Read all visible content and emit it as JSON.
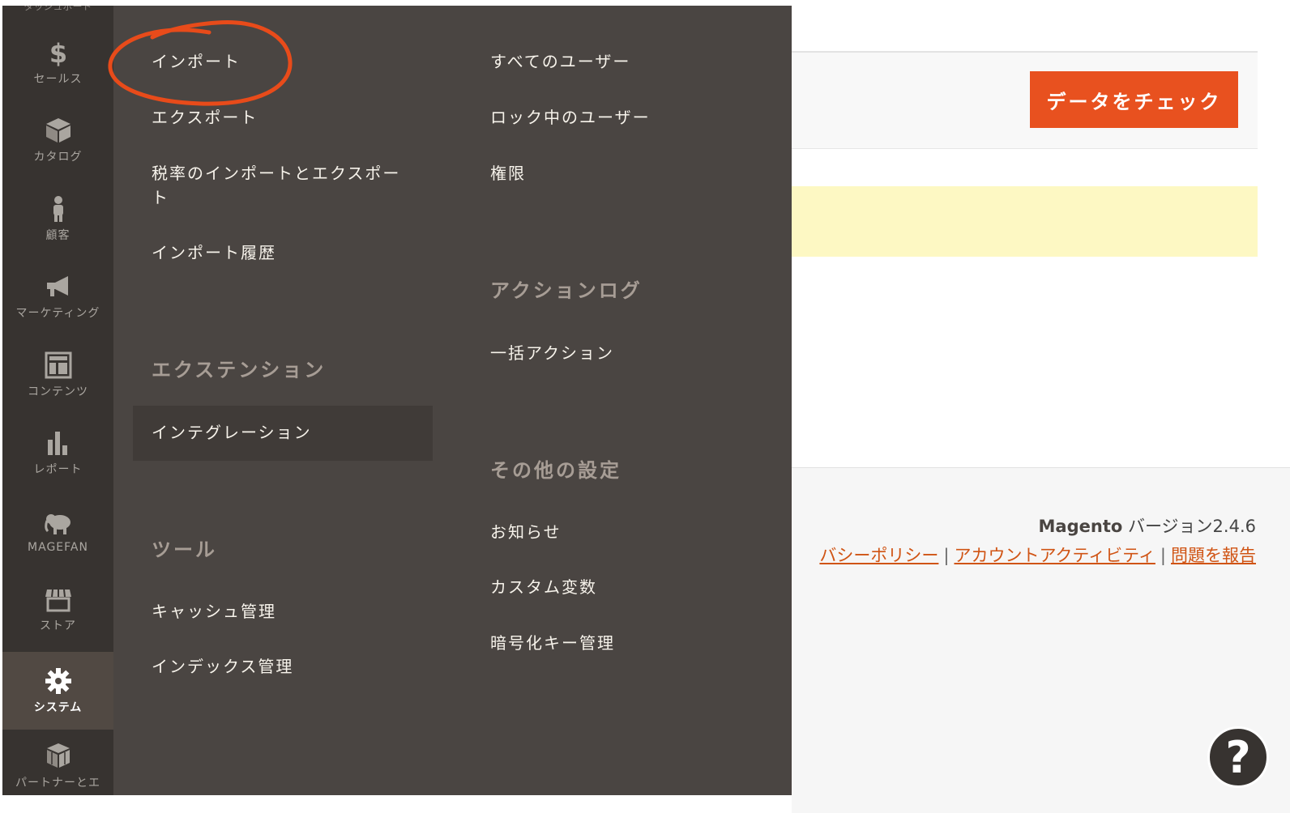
{
  "sidebar": {
    "top_cut": "ダッシュボード",
    "items": [
      {
        "label": "セールス",
        "icon": "dollar-icon"
      },
      {
        "label": "カタログ",
        "icon": "box-icon"
      },
      {
        "label": "顧客",
        "icon": "person-icon"
      },
      {
        "label": "マーケティング",
        "icon": "megaphone-icon"
      },
      {
        "label": "コンテンツ",
        "icon": "layout-icon"
      },
      {
        "label": "レポート",
        "icon": "bar-chart-icon"
      },
      {
        "label": "MAGEFAN",
        "icon": "elephant-icon"
      },
      {
        "label": "ストア",
        "icon": "storefront-icon"
      },
      {
        "label": "システム",
        "icon": "gear-icon",
        "active": true
      },
      {
        "label": "パートナーとエ",
        "icon": "cubes-icon"
      }
    ]
  },
  "flyout": {
    "col1": {
      "import": "インポート",
      "export": "エクスポート",
      "tax_rates": "税率のインポートとエクスポート",
      "import_history": "インポート履歴",
      "extensions_heading": "エクステンション",
      "integrations": "インテグレーション",
      "tools_heading": "ツール",
      "cache": "キャッシュ管理",
      "index": "インデックス管理"
    },
    "col2": {
      "all_users": "すべてのユーザー",
      "locked_users": "ロック中のユーザー",
      "permissions": "権限",
      "action_log_heading": "アクションログ",
      "bulk_actions": "一括アクション",
      "other_heading": "その他の設定",
      "notifications": "お知らせ",
      "custom_vars": "カスタム変数",
      "encryption": "暗号化キー管理"
    }
  },
  "main": {
    "check_button": "データをチェック",
    "version_brand": "Magento",
    "version_text": " バージョン2.4.6",
    "footer_links": {
      "privacy": "バシーポリシー",
      "activity": "アカウントアクティビティ",
      "report": "問題を報告",
      "sep": "|"
    },
    "help": "?"
  },
  "colors": {
    "sidebar": "#373330",
    "flyout": "#4a4542",
    "accent": "#e8511f",
    "annotation": "#e84b1a",
    "notice": "#fdf8c3"
  }
}
